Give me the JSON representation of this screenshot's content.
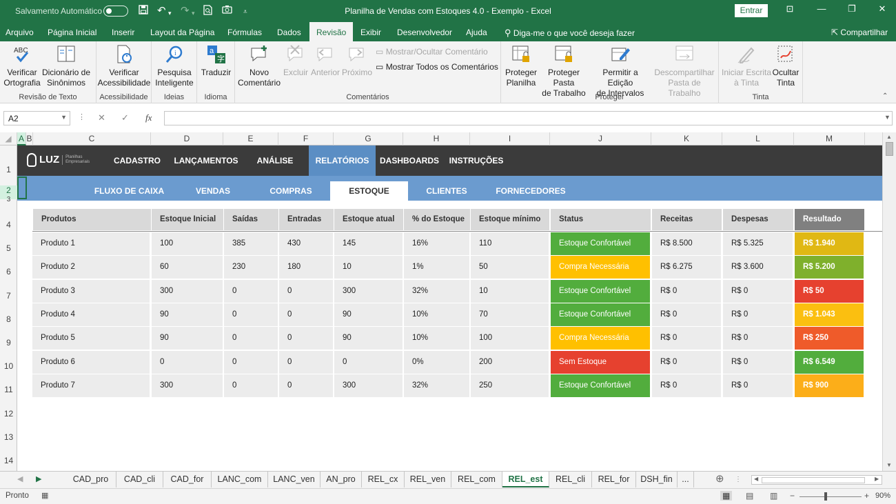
{
  "titlebar": {
    "autosave_label": "Salvamento Automático",
    "title": "Planilha de Vendas com Estoques 4.0 - Exemplo  -  Excel",
    "signin_label": "Entrar"
  },
  "menu": {
    "tabs": [
      "Arquivo",
      "Página Inicial",
      "Inserir",
      "Layout da Página",
      "Fórmulas",
      "Dados",
      "Revisão",
      "Exibir",
      "Desenvolvedor",
      "Ajuda"
    ],
    "active_tab": "Revisão",
    "tellme": "Diga-me o que você deseja fazer",
    "share": "Compartilhar"
  },
  "ribbon": {
    "groups": {
      "proofing": "Revisão de Texto",
      "accessibility": "Acessibilidade",
      "insights": "Ideias",
      "language": "Idioma",
      "comments": "Comentários",
      "protect": "Proteger",
      "ink": "Tinta"
    },
    "buttons": {
      "spelling_top": "Verificar",
      "spelling_bottom": "Ortografia",
      "thesaurus_top": "Dicionário de",
      "thesaurus_bottom": "Sinônimos",
      "check_acc_top": "Verificar",
      "check_acc_bottom": "Acessibilidade",
      "smart_top": "Pesquisa",
      "smart_bottom": "Inteligente",
      "translate": "Traduzir",
      "newcomment_top": "Novo",
      "newcomment_bottom": "Comentário",
      "delete": "Excluir",
      "previous": "Anterior",
      "next": "Próximo",
      "show_hide": "Mostrar/Ocultar Comentário",
      "show_all": "Mostrar Todos os Comentários",
      "protect_sheet_top": "Proteger",
      "protect_sheet_bottom": "Planilha",
      "protect_wb_top": "Proteger Pasta",
      "protect_wb_bottom": "de Trabalho",
      "allow_edit_top": "Permitir a Edição",
      "allow_edit_bottom": "de Intervalos",
      "unshare_top": "Descompartilhar",
      "unshare_bottom": "Pasta de Trabalho",
      "start_ink_top": "Iniciar Escrita",
      "start_ink_bottom": "à Tinta",
      "hide_ink_top": "Ocultar",
      "hide_ink_bottom": "Tinta"
    }
  },
  "formula": {
    "namebox": "A2",
    "fx": "fx",
    "content": ""
  },
  "columns": [
    "A",
    "B",
    "C",
    "D",
    "E",
    "F",
    "G",
    "H",
    "I",
    "J",
    "K",
    "L",
    "M"
  ],
  "rows": [
    "1",
    "2",
    "3",
    "4",
    "5",
    "6",
    "7",
    "8",
    "9",
    "10",
    "11",
    "12",
    "13",
    "14"
  ],
  "nav": {
    "logo": "LUZ",
    "logo_tag": "Planilhas Empresariais",
    "items": [
      "CADASTRO",
      "LANÇAMENTOS",
      "ANÁLISE",
      "RELATÓRIOS",
      "DASHBOARDS",
      "INSTRUÇÕES"
    ],
    "active": "RELATÓRIOS",
    "subitems": [
      "FLUXO DE CAIXA",
      "VENDAS",
      "COMPRAS",
      "ESTOQUE",
      "CLIENTES",
      "FORNECEDORES"
    ],
    "subactive": "ESTOQUE"
  },
  "table": {
    "headers": [
      "Produtos",
      "Estoque Inicial",
      "Saídas",
      "Entradas",
      "Estoque atual",
      "% do Estoque",
      "Estoque mínimo",
      "Status",
      "Receitas",
      "Despesas",
      "Resultado"
    ],
    "status_colors": {
      "Estoque Confortável": "#52ad3d",
      "Compra Necessária": "#ffc000",
      "Sem Estoque": "#e6412f"
    },
    "rows": [
      {
        "produto": "Produto 1",
        "inicial": "100",
        "saidas": "385",
        "entradas": "430",
        "atual": "145",
        "pct": "16%",
        "minimo": "110",
        "status": "Estoque Confortável",
        "receitas": "R$ 8.500",
        "despesas": "R$ 5.325",
        "resultado": "R$ 1.940",
        "resultado_color": "#e0b814"
      },
      {
        "produto": "Produto 2",
        "inicial": "60",
        "saidas": "230",
        "entradas": "180",
        "atual": "10",
        "pct": "1%",
        "minimo": "50",
        "status": "Compra Necessária",
        "receitas": "R$ 6.275",
        "despesas": "R$ 3.600",
        "resultado": "R$ 5.200",
        "resultado_color": "#7fb02c"
      },
      {
        "produto": "Produto 3",
        "inicial": "300",
        "saidas": "0",
        "entradas": "0",
        "atual": "300",
        "pct": "32%",
        "minimo": "10",
        "status": "Estoque Confortável",
        "receitas": "R$ 0",
        "despesas": "R$ 0",
        "resultado": "R$ 50",
        "resultado_color": "#e6412f"
      },
      {
        "produto": "Produto 4",
        "inicial": "90",
        "saidas": "0",
        "entradas": "0",
        "atual": "90",
        "pct": "10%",
        "minimo": "70",
        "status": "Estoque Confortável",
        "receitas": "R$ 0",
        "despesas": "R$ 0",
        "resultado": "R$ 1.043",
        "resultado_color": "#fbbf10"
      },
      {
        "produto": "Produto 5",
        "inicial": "90",
        "saidas": "0",
        "entradas": "0",
        "atual": "90",
        "pct": "10%",
        "minimo": "100",
        "status": "Compra Necessária",
        "receitas": "R$ 0",
        "despesas": "R$ 0",
        "resultado": "R$ 250",
        "resultado_color": "#ef5b2a"
      },
      {
        "produto": "Produto 6",
        "inicial": "0",
        "saidas": "0",
        "entradas": "0",
        "atual": "0",
        "pct": "0%",
        "minimo": "200",
        "status": "Sem Estoque",
        "receitas": "R$ 0",
        "despesas": "R$ 0",
        "resultado": "R$ 6.549",
        "resultado_color": "#52ad3d"
      },
      {
        "produto": "Produto 7",
        "inicial": "300",
        "saidas": "0",
        "entradas": "0",
        "atual": "300",
        "pct": "32%",
        "minimo": "250",
        "status": "Estoque Confortável",
        "receitas": "R$ 0",
        "despesas": "R$ 0",
        "resultado": "R$ 900",
        "resultado_color": "#fcae19"
      }
    ]
  },
  "sheet_tabs": [
    "CAD_pro",
    "CAD_cli",
    "CAD_for",
    "LANC_com",
    "LANC_ven",
    "AN_pro",
    "REL_cx",
    "REL_ven",
    "REL_com",
    "REL_est",
    "REL_cli",
    "REL_for",
    "DSH_fin",
    "..."
  ],
  "active_sheet": "REL_est",
  "status": {
    "ready": "Pronto",
    "zoom": "90%"
  }
}
